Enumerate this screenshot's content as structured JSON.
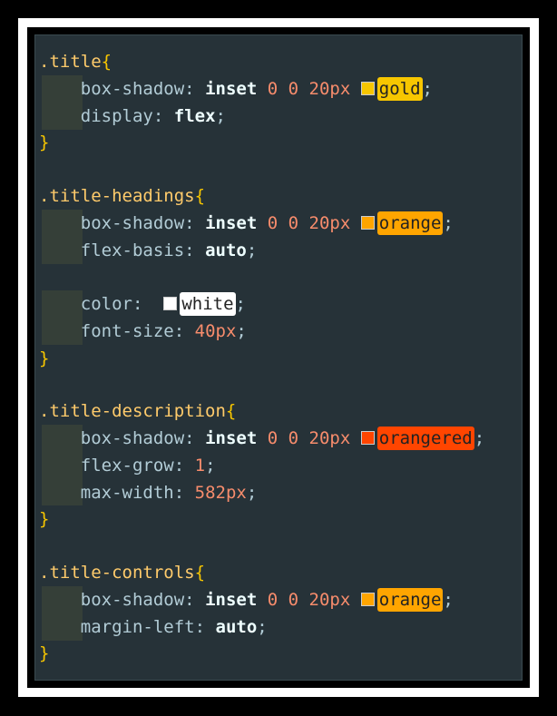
{
  "rules": [
    {
      "selector": ".title",
      "open_brace": "{",
      "close_brace": "}",
      "declarations": [
        {
          "property": "box-shadow",
          "keyword": "inset",
          "numbers": [
            "0",
            "0",
            "20px"
          ],
          "color_name": "gold",
          "color_hex": "#f7c600"
        },
        {
          "property": "display",
          "value": "flex"
        }
      ]
    },
    {
      "selector": ".title-headings",
      "open_brace": "{",
      "close_brace": "}",
      "declarations": [
        {
          "property": "box-shadow",
          "keyword": "inset",
          "numbers": [
            "0",
            "0",
            "20px"
          ],
          "color_name": "orange",
          "color_hex": "#ffa500"
        },
        {
          "property": "flex-basis",
          "value": "auto"
        },
        {
          "property": "color",
          "color_name": "white",
          "color_hex": "#ffffff"
        },
        {
          "property": "font-size",
          "number": "40px"
        }
      ]
    },
    {
      "selector": ".title-description",
      "open_brace": "{",
      "close_brace": "}",
      "declarations": [
        {
          "property": "box-shadow",
          "keyword": "inset",
          "numbers": [
            "0",
            "0",
            "20px"
          ],
          "color_name": "orangered",
          "color_hex": "#ff4500"
        },
        {
          "property": "flex-grow",
          "number": "1"
        },
        {
          "property": "max-width",
          "number": "582px"
        }
      ]
    },
    {
      "selector": ".title-controls",
      "open_brace": "{",
      "close_brace": "}",
      "declarations": [
        {
          "property": "box-shadow",
          "keyword": "inset",
          "numbers": [
            "0",
            "0",
            "20px"
          ],
          "color_name": "orange",
          "color_hex": "#ffa500"
        },
        {
          "property": "margin-left",
          "value": "auto"
        }
      ]
    }
  ],
  "punctuation": {
    "colon": ":",
    "semicolon": ";"
  },
  "theme": {
    "background": "#263238",
    "selector": "#ffcb6b",
    "brace": "#f7c600",
    "property": "#b2ccd6",
    "number": "#f78c6c",
    "indent_guide": "#353f38"
  }
}
